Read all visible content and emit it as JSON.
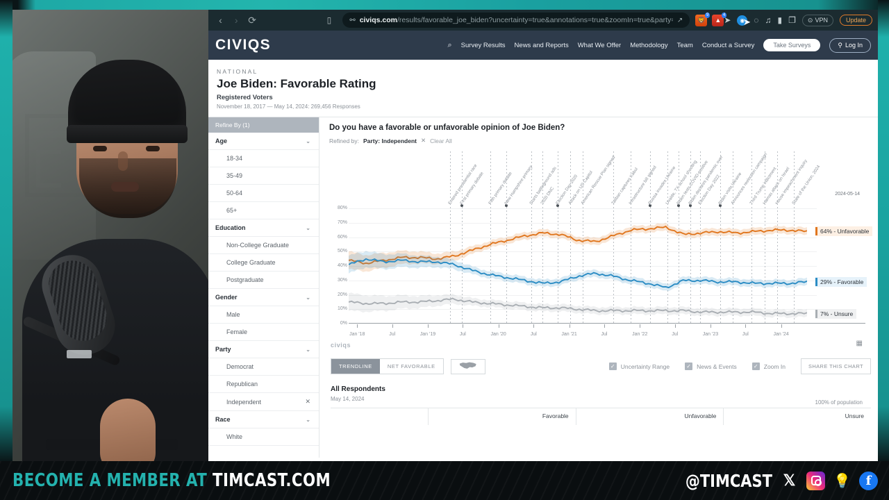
{
  "browser": {
    "back_icon": "‹",
    "forward_icon": "›",
    "reload_icon": "⟳",
    "bookmark_icon": "▯",
    "url_domain": "civiqs.com",
    "url_path": "/results/favorable_joe_biden?uncertainty=true&annotations=true&zoomIn=true&party=Independe…",
    "share_icon": "↗",
    "ext_brave_label": "",
    "ext_brave_badge": "9",
    "ext_red_badge": "4",
    "vpn_label": "VPN",
    "update_label": "Update"
  },
  "site_nav": {
    "logo": "CIVIQS",
    "search_icon": "⌕",
    "links": [
      "Survey Results",
      "News and Reports",
      "What We Offer",
      "Methodology",
      "Team",
      "Conduct a Survey"
    ],
    "take_surveys": "Take Surveys",
    "log_in": "Log In"
  },
  "title_block": {
    "eyebrow": "NATIONAL",
    "title": "Joe Biden: Favorable Rating",
    "subtitle": "Registered Voters",
    "meta": "November 18, 2017 — May 14, 2024:  269,456 Responses"
  },
  "sidebar": {
    "refine_header": "Refine By (1)",
    "groups": [
      {
        "label": "Age",
        "options": [
          "18-34",
          "35-49",
          "50-64",
          "65+"
        ]
      },
      {
        "label": "Education",
        "options": [
          "Non-College Graduate",
          "College Graduate",
          "Postgraduate"
        ]
      },
      {
        "label": "Gender",
        "options": [
          "Male",
          "Female"
        ]
      },
      {
        "label": "Party",
        "options": [
          "Democrat",
          "Republican",
          "Independent"
        ]
      },
      {
        "label": "Race",
        "options": [
          "White"
        ]
      }
    ],
    "chevron": "⌄",
    "remove_icon": "✕",
    "selected_option": "Independent"
  },
  "chart_panel": {
    "question": "Do you have a favorable or unfavorable opinion of Joe Biden?",
    "refined_by_label": "Refined by:",
    "refined_by_value": "Party: Independent",
    "refined_remove_icon": "✕",
    "clear_all": "Clear All",
    "datestamp": "2024-05-14",
    "watermark": "civiqs",
    "calendar_icon": "▦"
  },
  "chart_data": {
    "type": "line",
    "title": "Do you have a favorable or unfavorable opinion of Joe Biden?",
    "subtitle": "Registered Voters — Party: Independent",
    "xlabel": "",
    "ylabel": "",
    "ylim": [
      0,
      85
    ],
    "yticks": [
      "0%",
      "10%",
      "20%",
      "30%",
      "40%",
      "50%",
      "60%",
      "70%",
      "80%"
    ],
    "ytick_values": [
      0,
      10,
      20,
      30,
      40,
      50,
      60,
      70,
      80
    ],
    "xticks": [
      "Jan '18",
      "Jul",
      "Jan '19",
      "Jul",
      "Jan '20",
      "Jul",
      "Jan '21",
      "Jul",
      "Jan '22",
      "Jul",
      "Jan '23",
      "Jul",
      "Jan '24"
    ],
    "grid": true,
    "uncertainty_bands": true,
    "legend_position": "right-inline",
    "end_date": "2024-05-14",
    "series": [
      {
        "name": "Unfavorable",
        "color": "#e0761e",
        "end_label": "64% - Unfavorable",
        "end_value": 64,
        "x": [
          "2017-11",
          "2018-02",
          "2018-05",
          "2018-08",
          "2018-11",
          "2019-02",
          "2019-05",
          "2019-08",
          "2019-11",
          "2020-02",
          "2020-05",
          "2020-08",
          "2020-11",
          "2021-02",
          "2021-05",
          "2021-08",
          "2021-11",
          "2022-02",
          "2022-05",
          "2022-08",
          "2022-11",
          "2023-02",
          "2023-05",
          "2023-08",
          "2023-11",
          "2024-02",
          "2024-05"
        ],
        "values": [
          44,
          42,
          44,
          46,
          46,
          45,
          47,
          51,
          55,
          58,
          61,
          63,
          62,
          58,
          57,
          61,
          65,
          66,
          67,
          62,
          63,
          64,
          63,
          64,
          65,
          65,
          64
        ]
      },
      {
        "name": "Favorable",
        "color": "#2b8cc4",
        "end_label": "29% - Favorable",
        "end_value": 29,
        "x": [
          "2017-11",
          "2018-02",
          "2018-05",
          "2018-08",
          "2018-11",
          "2019-02",
          "2019-05",
          "2019-08",
          "2019-11",
          "2020-02",
          "2020-05",
          "2020-08",
          "2020-11",
          "2021-02",
          "2021-05",
          "2021-08",
          "2021-11",
          "2022-02",
          "2022-05",
          "2022-08",
          "2022-11",
          "2023-02",
          "2023-05",
          "2023-08",
          "2023-11",
          "2024-02",
          "2024-05"
        ],
        "values": [
          41,
          45,
          43,
          44,
          43,
          43,
          41,
          37,
          34,
          32,
          30,
          28,
          29,
          33,
          35,
          33,
          30,
          28,
          25,
          30,
          30,
          29,
          29,
          28,
          28,
          28,
          29
        ]
      },
      {
        "name": "Unsure",
        "color": "#a9aeb3",
        "end_label": "7% - Unsure",
        "end_value": 7,
        "x": [
          "2017-11",
          "2018-02",
          "2018-05",
          "2018-08",
          "2018-11",
          "2019-02",
          "2019-05",
          "2019-08",
          "2019-11",
          "2020-02",
          "2020-05",
          "2020-08",
          "2020-11",
          "2021-02",
          "2021-05",
          "2021-08",
          "2021-11",
          "2022-02",
          "2022-05",
          "2022-08",
          "2022-11",
          "2023-02",
          "2023-05",
          "2023-08",
          "2023-11",
          "2024-02",
          "2024-05"
        ],
        "values": [
          15,
          14,
          14,
          15,
          15,
          16,
          17,
          15,
          14,
          13,
          12,
          11,
          11,
          10,
          9,
          9,
          9,
          9,
          9,
          9,
          8,
          8,
          8,
          8,
          7,
          7,
          7
        ]
      }
    ],
    "annotations": [
      {
        "label": "Entered presidential race",
        "date": "2019-04-25",
        "dot": false
      },
      {
        "label": "First primary debate",
        "date": "2019-06-27",
        "dot": true
      },
      {
        "label": "Fifth primary debate",
        "date": "2019-11-20",
        "dot": false
      },
      {
        "label": "New Hampshire primary",
        "date": "2020-02-11",
        "dot": true
      },
      {
        "label": "Starts battleground ads",
        "date": "2020-06-19",
        "dot": false
      },
      {
        "label": "2020 DNC",
        "date": "2020-08-17",
        "dot": false
      },
      {
        "label": "Election Day 2020",
        "date": "2020-11-03",
        "dot": true
      },
      {
        "label": "Attack on US Capitol",
        "date": "2021-01-06",
        "dot": false
      },
      {
        "label": "American Rescue Plan signed",
        "date": "2021-03-11",
        "dot": false
      },
      {
        "label": "Taliban captures Kabul",
        "date": "2021-08-15",
        "dot": false
      },
      {
        "label": "Infrastructure bill signed",
        "date": "2021-11-15",
        "dot": false
      },
      {
        "label": "Russia invades Ukraine",
        "date": "2022-02-24",
        "dot": true
      },
      {
        "label": "Uvalde, TX school shooting",
        "date": "2022-05-24",
        "dot": false
      },
      {
        "label": "Biden tests COVID-positive",
        "date": "2022-07-21",
        "dot": true
      },
      {
        "label": "Biden declares pandemic over",
        "date": "2022-09-18",
        "dot": true
      },
      {
        "label": "Election Day 2022",
        "date": "2022-11-08",
        "dot": false
      },
      {
        "label": "Biden visits Ukraine",
        "date": "2023-02-20",
        "dot": true
      },
      {
        "label": "Announces reelection campaign",
        "date": "2023-04-25",
        "dot": false
      },
      {
        "label": "Third Trump indictment",
        "date": "2023-08-01",
        "dot": false
      },
      {
        "label": "Hamas attack on Israel",
        "date": "2023-10-07",
        "dot": false
      },
      {
        "label": "House impeachment inquiry",
        "date": "2023-12-13",
        "dot": false
      },
      {
        "label": "State of the Union, 2024",
        "date": "2024-03-07",
        "dot": false
      }
    ]
  },
  "controls": {
    "trendline": "TRENDLINE",
    "net_favorable": "NET FAVORABLE",
    "map_icon": "us-map-icon",
    "uncertainty_range": "Uncertainty Range",
    "news_events": "News & Events",
    "zoom_in": "Zoom In",
    "share_chart": "SHARE THIS CHART",
    "check_glyph": "✓"
  },
  "respondents": {
    "title": "All Respondents",
    "date": "May 14, 2024",
    "population": "100% of population",
    "columns": [
      "",
      "Favorable",
      "Unfavorable",
      "Unsure"
    ]
  },
  "banner": {
    "left_teal": "BECOME A MEMBER AT",
    "left_white": "TIMCAST.COM",
    "handle": "@TIMCAST",
    "icons": [
      "x-icon",
      "instagram-icon",
      "bulb-icon",
      "facebook-icon"
    ],
    "x_glyph": "𝕏",
    "bulb_glyph": "💡",
    "fb_glyph": "f"
  }
}
